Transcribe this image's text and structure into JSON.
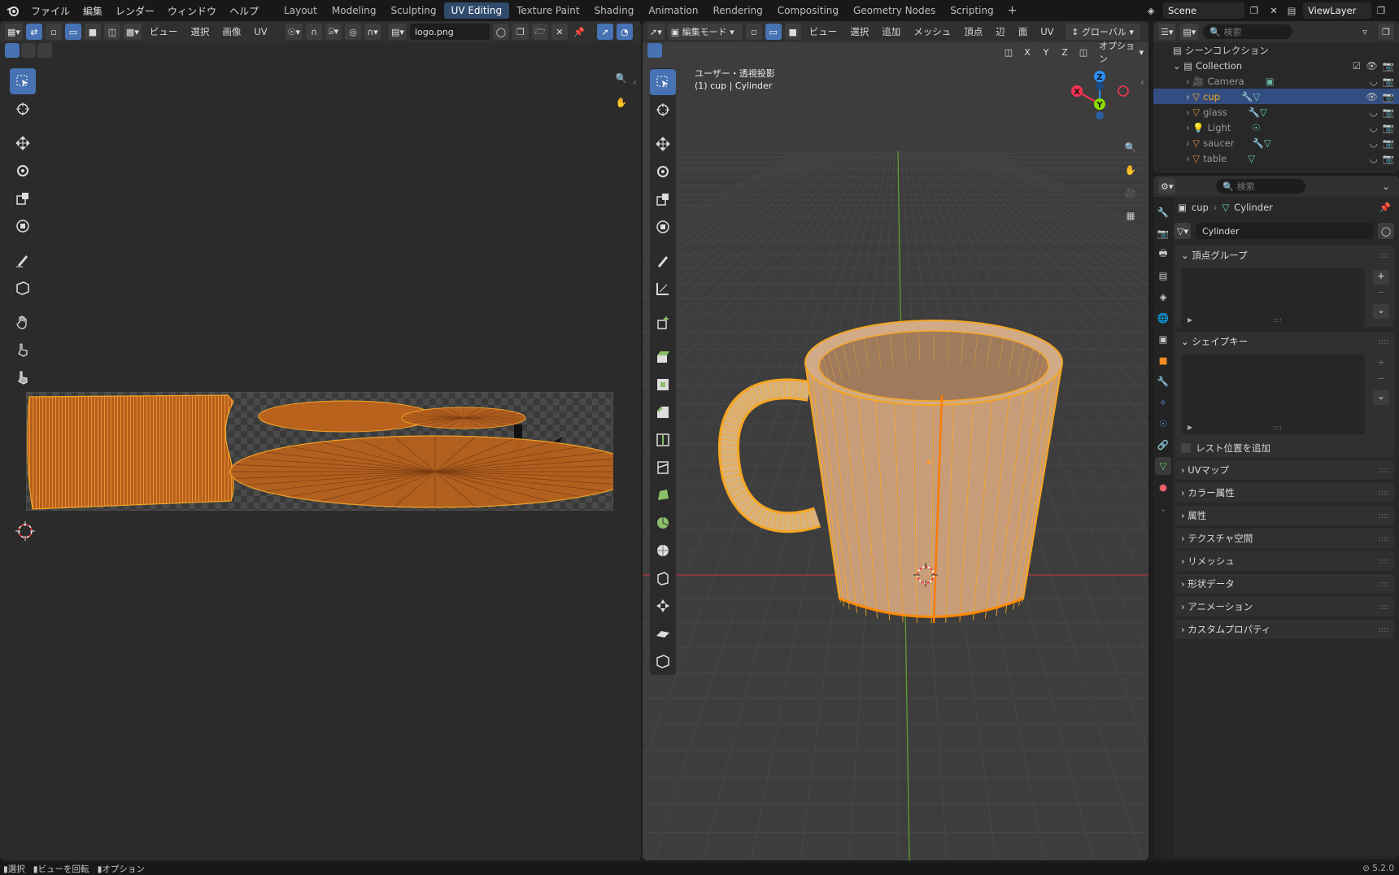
{
  "topbar": {
    "menus": [
      "ファイル",
      "編集",
      "レンダー",
      "ウィンドウ",
      "ヘルプ"
    ],
    "workspaces": [
      "Layout",
      "Modeling",
      "Sculpting",
      "UV Editing",
      "Texture Paint",
      "Shading",
      "Animation",
      "Rendering",
      "Compositing",
      "Geometry Nodes",
      "Scripting"
    ],
    "active_workspace": "UV Editing",
    "scene": "Scene",
    "view_layer": "ViewLayer"
  },
  "uv_editor": {
    "menus": [
      "ビュー",
      "選択",
      "画像",
      "UV"
    ],
    "image_name": "logo.png"
  },
  "viewport": {
    "mode": "編集モード",
    "menus": [
      "ビュー",
      "選択",
      "追加",
      "メッシュ",
      "頂点",
      "辺",
      "面",
      "UV"
    ],
    "orientation": "グローバル",
    "options": "オプション",
    "view_name": "ユーザー・透視投影",
    "object_info": "(1) cup | Cylinder",
    "axes": {
      "x": "X",
      "y": "Y",
      "z": "Z"
    }
  },
  "outliner": {
    "search_placeholder": "検索",
    "scene_collection": "シーンコレクション",
    "collection": "Collection",
    "items": [
      "Camera",
      "cup",
      "glass",
      "Light",
      "saucer",
      "table"
    ],
    "selected": "cup"
  },
  "properties": {
    "search_placeholder": "検索",
    "breadcrumb_object": "cup",
    "breadcrumb_data": "Cylinder",
    "mesh_name": "Cylinder",
    "vertex_groups": "頂点グループ",
    "shape_keys": "シェイプキー",
    "add_rest_position": "レスト位置を追加",
    "collapsed_panels": [
      "UVマップ",
      "カラー属性",
      "属性",
      "テクスチャ空間",
      "リメッシュ",
      "形状データ",
      "アニメーション",
      "カスタムプロパティ"
    ]
  },
  "statusbar": {
    "items": [
      "選択",
      "ビューを回転",
      "オプション"
    ],
    "version": "5.2.0"
  },
  "colors": {
    "accent": "#4772b3",
    "selected_orange": "#f5a623",
    "mesh_orange": "#b8621e",
    "axis_x": "#ff3352",
    "axis_y": "#8bdc00",
    "axis_z": "#2890ff"
  }
}
